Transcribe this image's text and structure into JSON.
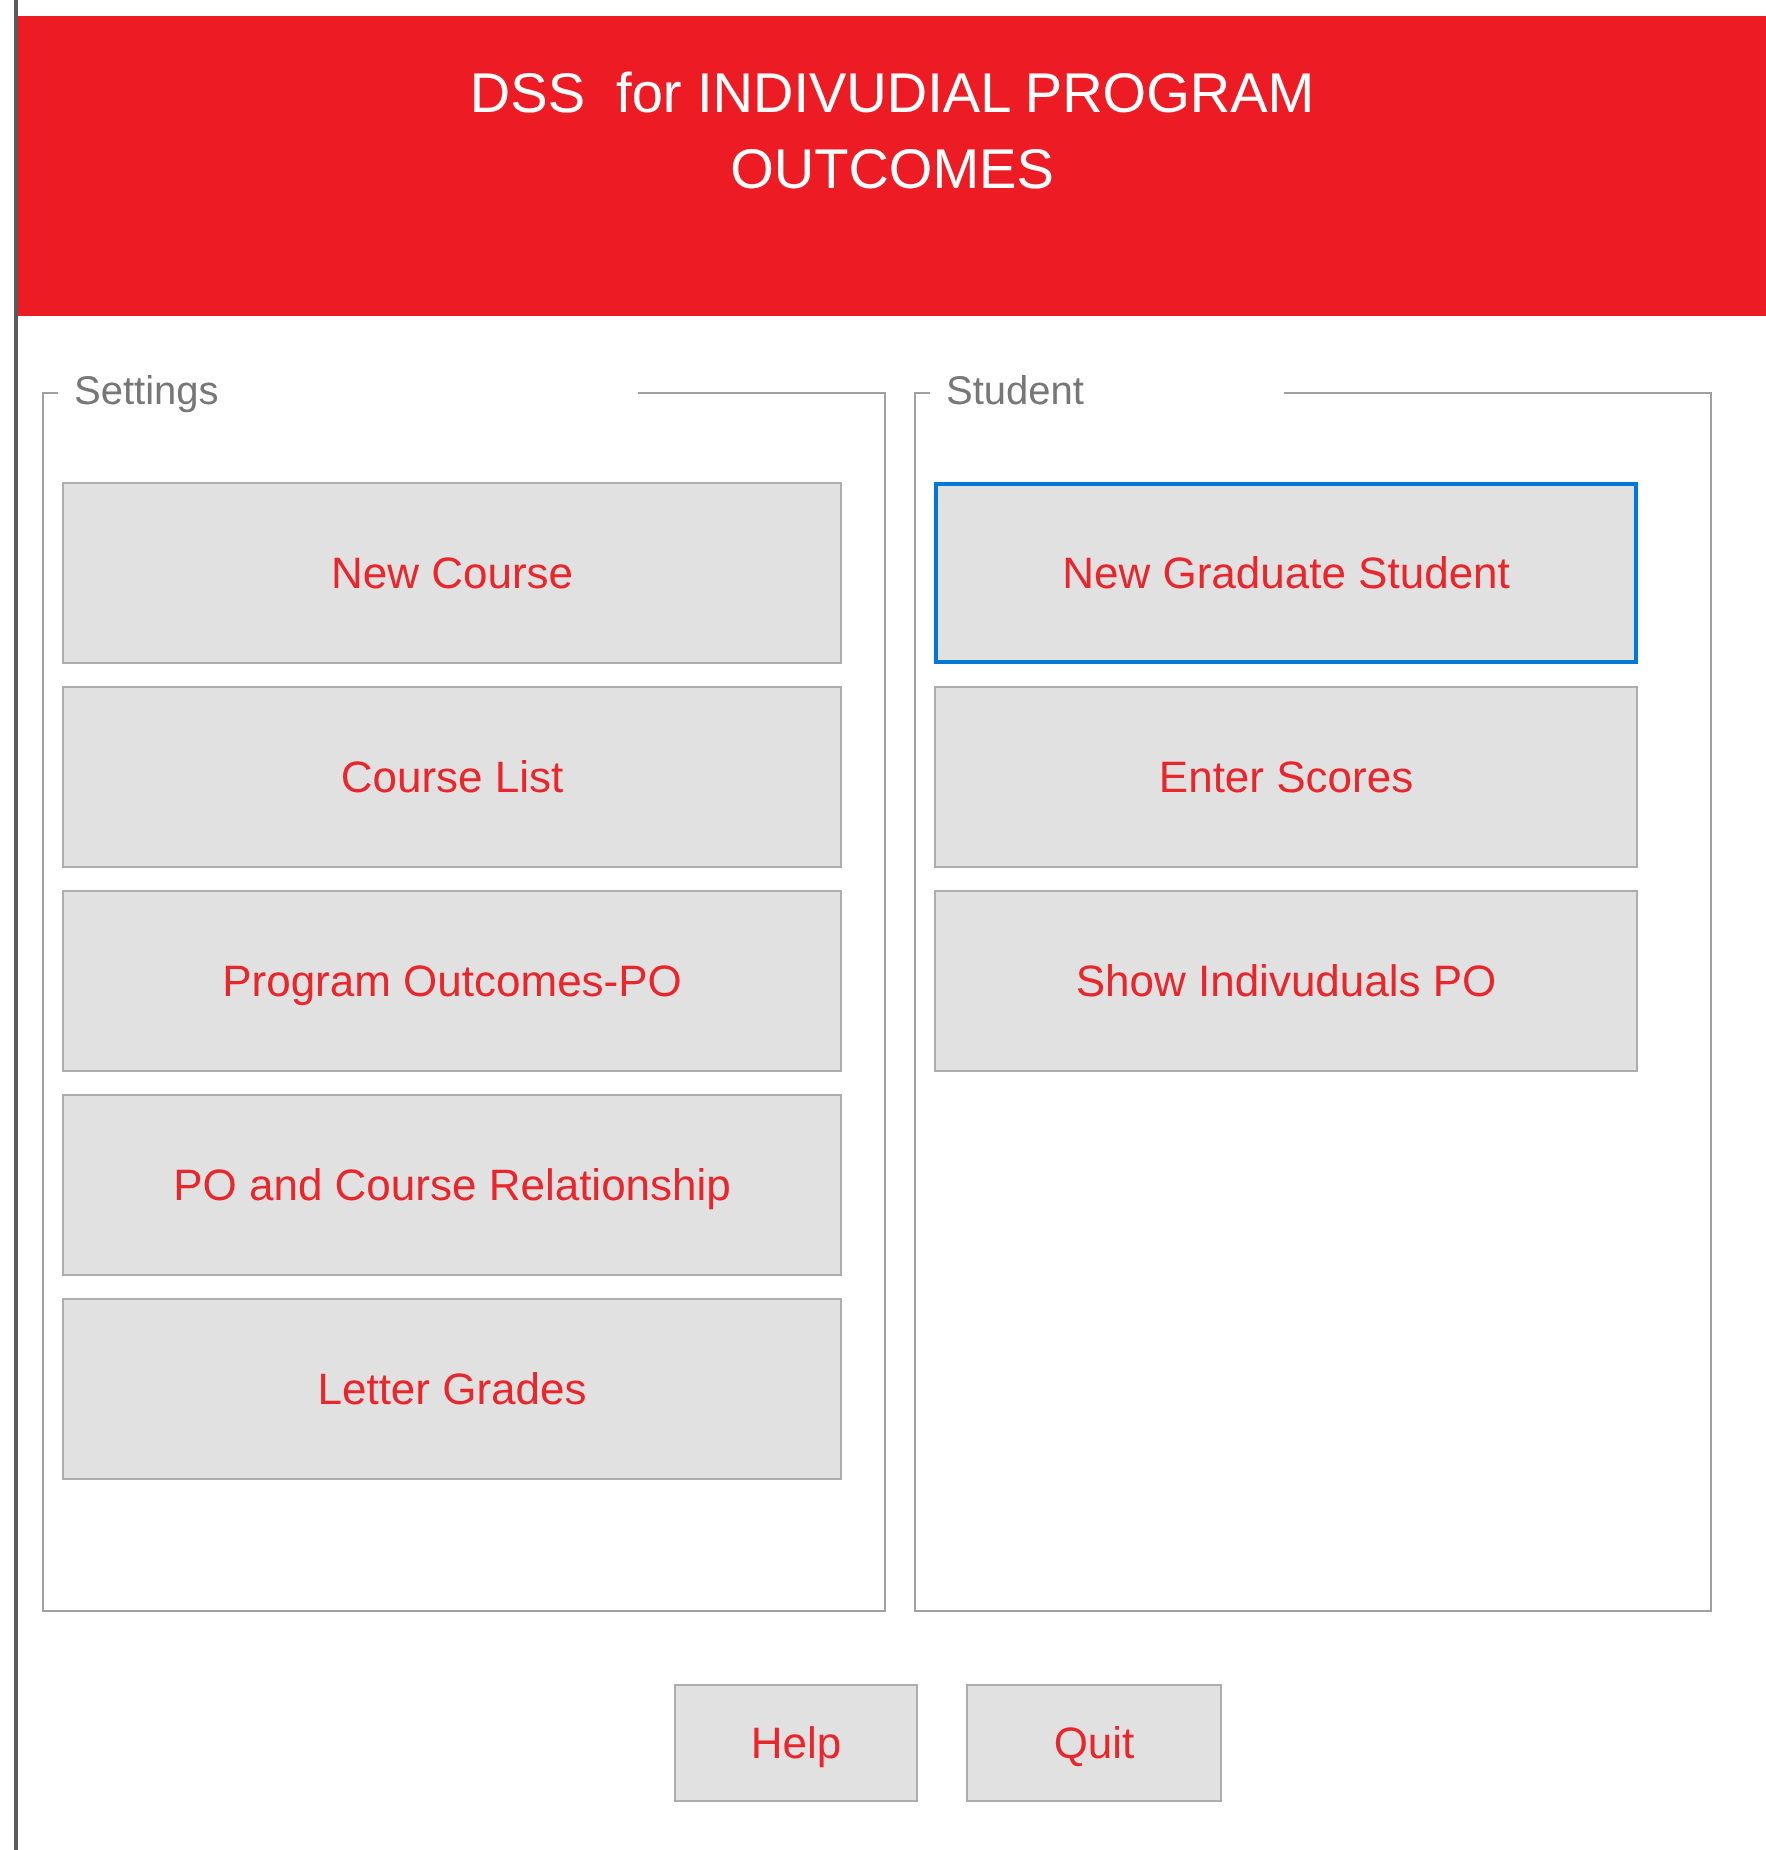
{
  "header": {
    "title": "DSS  for INDIVUDIAL PROGRAM OUTCOMES"
  },
  "groups": [
    {
      "label": "Settings",
      "buttons": [
        {
          "label": "New Course",
          "selected": false
        },
        {
          "label": "Course List",
          "selected": false
        },
        {
          "label": "Program Outcomes-PO",
          "selected": false
        },
        {
          "label": "PO and Course Relationship",
          "selected": false
        },
        {
          "label": "Letter Grades",
          "selected": false
        }
      ]
    },
    {
      "label": "Student",
      "buttons": [
        {
          "label": "New Graduate Student",
          "selected": true
        },
        {
          "label": "Enter Scores",
          "selected": false
        },
        {
          "label": "Show Indivuduals PO",
          "selected": false
        }
      ]
    }
  ],
  "footer_buttons": [
    "Help",
    "Quit"
  ]
}
